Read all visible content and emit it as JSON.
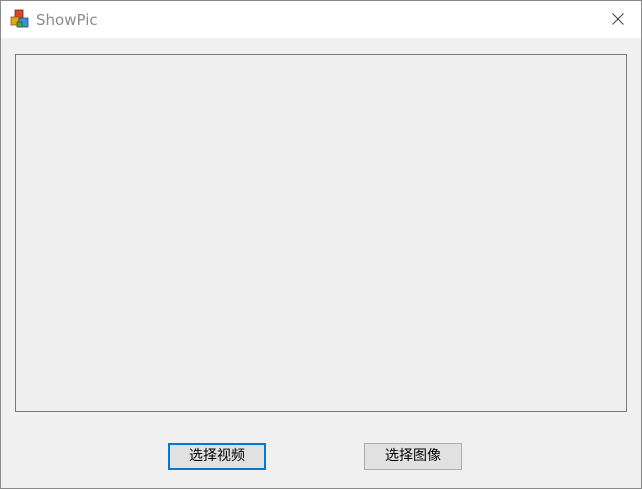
{
  "window": {
    "title": "ShowPic",
    "app_icon": "app-cubes-icon",
    "close_icon": "close-icon"
  },
  "buttons": {
    "select_video": "选择视频",
    "select_image": "选择图像"
  },
  "colors": {
    "accent": "#0078d7",
    "window_bg": "#f0f0f0",
    "titlebar_bg": "#ffffff",
    "title_text": "#8c8c8c"
  }
}
